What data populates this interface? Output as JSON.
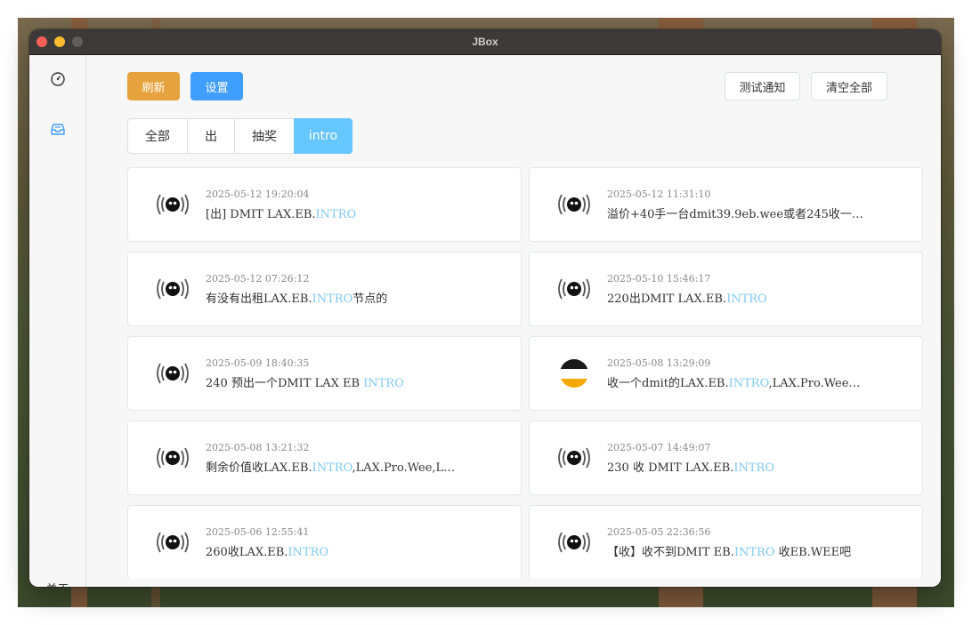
{
  "app": {
    "title": "JBox"
  },
  "sidebar": {
    "items": [
      {
        "icon": "dashboard-icon"
      },
      {
        "icon": "inbox-icon"
      }
    ],
    "about_label": "关于"
  },
  "toolbar": {
    "refresh_label": "刷新",
    "settings_label": "设置",
    "test_notify_label": "测试通知",
    "clear_all_label": "清空全部"
  },
  "tabs": [
    {
      "label": "全部",
      "active": false
    },
    {
      "label": "出",
      "active": false
    },
    {
      "label": "抽奖",
      "active": false
    },
    {
      "label": "intro",
      "active": true
    }
  ],
  "colors": {
    "accent_blue": "#409eff",
    "accent_orange": "#e6a23c",
    "active_tab": "#66c6ff",
    "keyword_highlight": "#7fcaf0"
  },
  "posts": [
    {
      "time": "2025-05-12 19:20:04",
      "pre": "[出] DMIT LAX.EB.",
      "hl": "INTRO",
      "post": "",
      "avatar": "broadcast-avatar-icon"
    },
    {
      "time": "2025-05-12 11:31:10",
      "pre": "溢价+40手一台dmit39.9eb.wee或者245收一…",
      "hl": "",
      "post": "",
      "avatar": "broadcast-avatar-icon"
    },
    {
      "time": "2025-05-12 07:26:12",
      "pre": "有没有出租LAX.EB.",
      "hl": "INTRO",
      "post": "节点的",
      "avatar": "broadcast-avatar-icon"
    },
    {
      "time": "2025-05-10 15:46:17",
      "pre": "220出DMIT LAX.EB.",
      "hl": "INTRO",
      "post": "",
      "avatar": "broadcast-avatar-icon"
    },
    {
      "time": "2025-05-09 18:40:35",
      "pre": "240 预出一个DMIT LAX EB ",
      "hl": "INTRO",
      "post": "",
      "avatar": "broadcast-avatar-icon"
    },
    {
      "time": "2025-05-08 13:29:09",
      "pre": "收一个dmit的LAX.EB.",
      "hl": "INTRO",
      "post": ",LAX.Pro.Wee…",
      "avatar": "flag-avatar-icon"
    },
    {
      "time": "2025-05-08 13:21:32",
      "pre": "剩余价值收LAX.EB.",
      "hl": "INTRO",
      "post": ",LAX.Pro.Wee,L…",
      "avatar": "broadcast-avatar-icon"
    },
    {
      "time": "2025-05-07 14:49:07",
      "pre": "230 收 DMIT LAX.EB.",
      "hl": "INTRO",
      "post": "",
      "avatar": "broadcast-avatar-icon"
    },
    {
      "time": "2025-05-06 12:55:41",
      "pre": "260收LAX.EB.",
      "hl": "INTRO",
      "post": "",
      "avatar": "broadcast-avatar-icon"
    },
    {
      "time": "2025-05-05 22:36:56",
      "pre": "【收】收不到DMIT EB.",
      "hl": "INTRO",
      "post": " 收EB.WEE吧",
      "avatar": "broadcast-avatar-icon"
    }
  ]
}
